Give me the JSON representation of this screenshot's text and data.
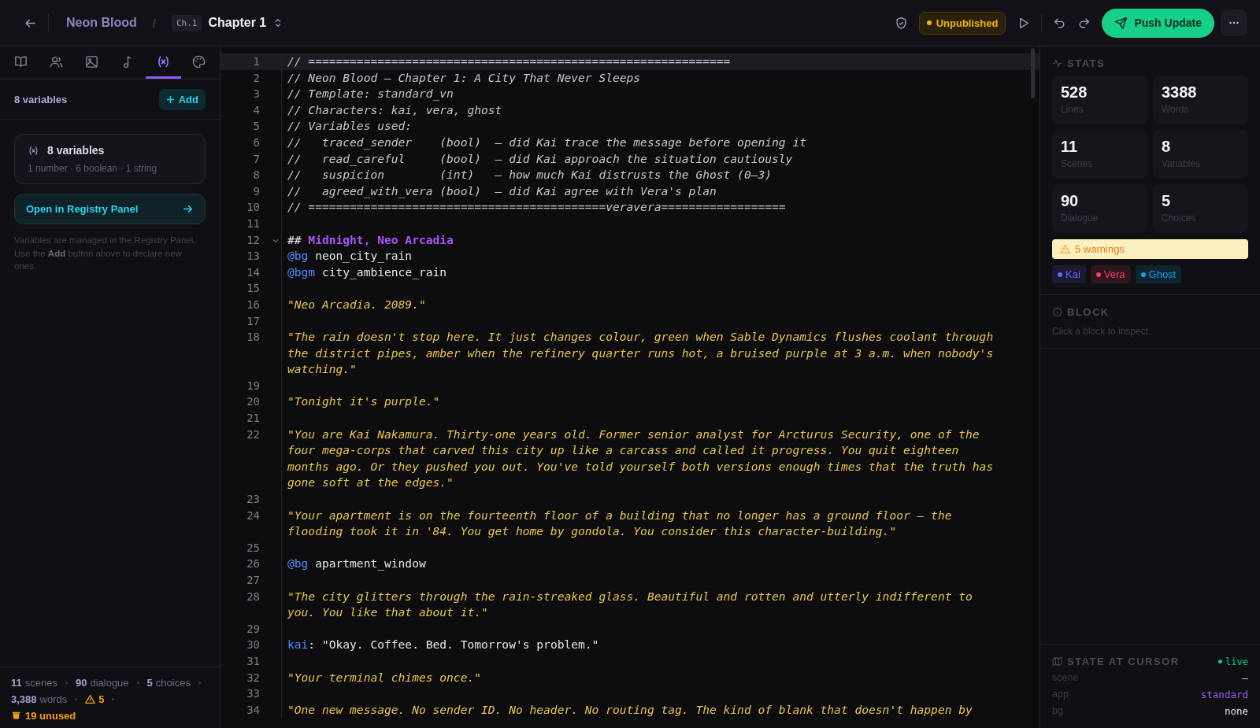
{
  "topbar": {
    "project": "Neon Blood",
    "separator": "/",
    "chapter_badge": "Ch.1",
    "chapter": "Chapter 1",
    "status": "Unpublished",
    "push_button": "Push Update"
  },
  "sidebar": {
    "tabs": [
      {
        "kind": "book",
        "selected": false
      },
      {
        "kind": "people",
        "selected": false
      },
      {
        "kind": "image",
        "selected": false
      },
      {
        "kind": "music",
        "selected": false
      },
      {
        "kind": "variable",
        "selected": true
      },
      {
        "kind": "palette",
        "selected": false
      }
    ],
    "header": {
      "title": "8 variables",
      "add_button": "Add"
    },
    "summary_card": {
      "title": "8 variables",
      "detail": "1 number · 6 boolean · 1 string"
    },
    "registry_button": "Open in Registry Panel",
    "help_text": "Variables are managed in the Registry Panel. Use the **Add** button above to declare new ones.",
    "footer": {
      "stats": [
        "**11** scenes",
        "**90** dialogue",
        "**5** choices",
        "**3,388** words"
      ],
      "warnings": "5",
      "unused": "19 unused"
    }
  },
  "editor": {
    "lines": [
      {
        "n": "1",
        "current": true,
        "fold": false,
        "parts": [
          {
            "kind": "comment",
            "t": "// ============================================================="
          }
        ]
      },
      {
        "n": "2",
        "current": false,
        "fold": false,
        "parts": [
          {
            "kind": "comment",
            "t": "// Neon Blood — Chapter 1: A City That Never Sleeps"
          }
        ]
      },
      {
        "n": "3",
        "current": false,
        "fold": false,
        "parts": [
          {
            "kind": "comment",
            "t": "// Template: standard_vn"
          }
        ]
      },
      {
        "n": "4",
        "current": false,
        "fold": false,
        "parts": [
          {
            "kind": "comment",
            "t": "// Characters: kai, vera, ghost"
          }
        ]
      },
      {
        "n": "5",
        "current": false,
        "fold": false,
        "parts": [
          {
            "kind": "comment",
            "t": "// Variables used:"
          }
        ]
      },
      {
        "n": "6",
        "current": false,
        "fold": false,
        "parts": [
          {
            "kind": "comment",
            "t": "//   traced_sender    (bool)  — did Kai trace the message before opening it"
          }
        ]
      },
      {
        "n": "7",
        "current": false,
        "fold": false,
        "parts": [
          {
            "kind": "comment",
            "t": "//   read_careful     (bool)  — did Kai approach the situation cautiously"
          }
        ]
      },
      {
        "n": "8",
        "current": false,
        "fold": false,
        "parts": [
          {
            "kind": "comment",
            "t": "//   suspicion        (int)   — how much Kai distrusts the Ghost (0–3)"
          }
        ]
      },
      {
        "n": "9",
        "current": false,
        "fold": false,
        "parts": [
          {
            "kind": "comment",
            "t": "//   agreed_with_vera (bool)  — did Kai agree with Vera's plan"
          }
        ]
      },
      {
        "n": "10",
        "current": false,
        "fold": false,
        "parts": [
          {
            "kind": "comment",
            "t": "// ===========================================veravera=================="
          }
        ]
      },
      {
        "n": "11",
        "current": false,
        "fold": false
      },
      {
        "n": "12",
        "current": false,
        "fold": true,
        "parts": [
          {
            "kind": "plain",
            "t": "## "
          },
          {
            "kind": "heading",
            "t": "Midnight, Neo Arcadia"
          }
        ]
      },
      {
        "n": "13",
        "current": false,
        "fold": false,
        "parts": [
          {
            "kind": "directive",
            "t": "@bg"
          },
          {
            "kind": "plain",
            "t": " neon_city_rain"
          }
        ]
      },
      {
        "n": "14",
        "current": false,
        "fold": false,
        "parts": [
          {
            "kind": "directive",
            "t": "@bgm"
          },
          {
            "kind": "plain",
            "t": " city_ambience_rain"
          }
        ]
      },
      {
        "n": "15",
        "current": false,
        "fold": false
      },
      {
        "n": "16",
        "current": false,
        "fold": false,
        "parts": [
          {
            "kind": "narration",
            "t": "\"Neo Arcadia. 2089.\""
          }
        ]
      },
      {
        "n": "17",
        "current": false,
        "fold": false
      },
      {
        "n": "18",
        "current": false,
        "fold": false,
        "parts": [
          {
            "kind": "narration",
            "t": "\"The rain doesn't stop here. It just changes colour, green when Sable Dynamics flushes coolant through the district pipes, amber when the refinery quarter runs hot, a bruised purple at 3 a.m. when nobody's watching.\""
          }
        ]
      },
      {
        "n": "19",
        "current": false,
        "fold": false
      },
      {
        "n": "20",
        "current": false,
        "fold": false,
        "parts": [
          {
            "kind": "narration",
            "t": "\"Tonight it's purple.\""
          }
        ]
      },
      {
        "n": "21",
        "current": false,
        "fold": false
      },
      {
        "n": "22",
        "current": false,
        "fold": false,
        "parts": [
          {
            "kind": "narration",
            "t": "\"You are Kai Nakamura. Thirty-one years old. Former senior analyst for Arcturus Security, one of the four mega-corps that carved this city up like a carcass and called it progress. You quit eighteen months ago. Or they pushed you out. You've told yourself both versions enough times that the truth has gone soft at the edges.\""
          }
        ]
      },
      {
        "n": "23",
        "current": false,
        "fold": false
      },
      {
        "n": "24",
        "current": false,
        "fold": false,
        "parts": [
          {
            "kind": "narration",
            "t": "\"Your apartment is on the fourteenth floor of a building that no longer has a ground floor — the flooding took it in '84. You get home by gondola. You consider this character-building.\""
          }
        ]
      },
      {
        "n": "25",
        "current": false,
        "fold": false
      },
      {
        "n": "26",
        "current": false,
        "fold": false,
        "parts": [
          {
            "kind": "directive",
            "t": "@bg"
          },
          {
            "kind": "plain",
            "t": " apartment_window"
          }
        ]
      },
      {
        "n": "27",
        "current": false,
        "fold": false
      },
      {
        "n": "28",
        "current": false,
        "fold": false,
        "parts": [
          {
            "kind": "narration",
            "t": "\"The city glitters through the rain-streaked glass. Beautiful and rotten and utterly indifferent to you. You like that about it.\""
          }
        ]
      },
      {
        "n": "29",
        "current": false,
        "fold": false
      },
      {
        "n": "30",
        "current": false,
        "fold": false,
        "parts": [
          {
            "kind": "speaker",
            "t": "kai"
          },
          {
            "kind": "plain",
            "t": ": \"Okay. Coffee. Bed. Tomorrow's problem.\""
          }
        ]
      },
      {
        "n": "31",
        "current": false,
        "fold": false
      },
      {
        "n": "32",
        "current": false,
        "fold": false,
        "parts": [
          {
            "kind": "narration",
            "t": "\"Your terminal chimes once.\""
          }
        ]
      },
      {
        "n": "33",
        "current": false,
        "fold": false
      },
      {
        "n": "34",
        "current": false,
        "fold": false,
        "parts": [
          {
            "kind": "narration",
            "t": "\"One new message. No sender ID. No header. No routing tag. The kind of blank that doesn't happen by"
          }
        ]
      }
    ]
  },
  "inspector": {
    "stats_title": "STATS",
    "stats": [
      {
        "value": "528",
        "label": "Lines"
      },
      {
        "value": "3388",
        "label": "Words"
      },
      {
        "value": "11",
        "label": "Scenes"
      },
      {
        "value": "8",
        "label": "Variables"
      },
      {
        "value": "90",
        "label": "Dialogue"
      },
      {
        "value": "5",
        "label": "Choices"
      }
    ],
    "warnings": "5 warnings",
    "characters": [
      {
        "name": "Kai",
        "color": "#6c63ff"
      },
      {
        "name": "Vera",
        "color": "#f43f5e"
      },
      {
        "name": "Ghost",
        "color": "#0ea5e9"
      }
    ],
    "block_title": "BLOCK",
    "block_hint": "Click a block to inspect.",
    "state_title": "STATE AT CURSOR",
    "live": "live",
    "state_rows": [
      {
        "key": "scene",
        "value": "—",
        "kind": "plain"
      },
      {
        "key": "app",
        "value": "standard",
        "kind": "accent"
      },
      {
        "key": "bg",
        "value": "none",
        "kind": "plain"
      }
    ]
  }
}
